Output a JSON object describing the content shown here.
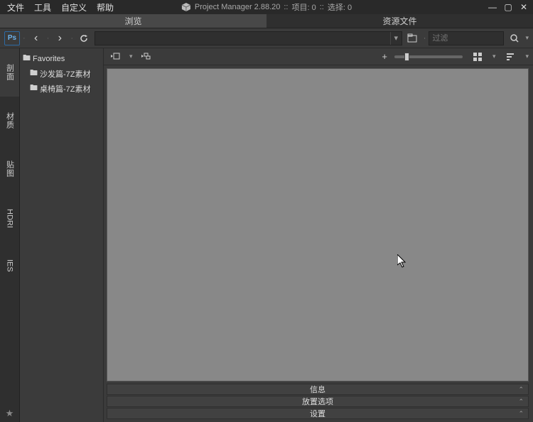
{
  "title": {
    "app": "Project Manager 2.88.20",
    "projects": "项目: 0",
    "sel": "选择: 0",
    "sep": "::"
  },
  "menu": {
    "file": "文件",
    "tools": "工具",
    "custom": "自定义",
    "help": "帮助"
  },
  "tabs": {
    "browse": "浏览",
    "resources": "资源文件"
  },
  "filter": {
    "placeholder": "过滤"
  },
  "sideTabs": {
    "t1": "剖面",
    "t2": "材质",
    "t3": "贴图",
    "t4": "HDRI",
    "t5": "IES"
  },
  "tree": {
    "root": "Favorites",
    "items": [
      "沙发篇-7Z素材",
      "桌椅篇-7Z素材"
    ]
  },
  "panels": {
    "info": "信息",
    "placement": "放置选项",
    "settings": "设置"
  }
}
